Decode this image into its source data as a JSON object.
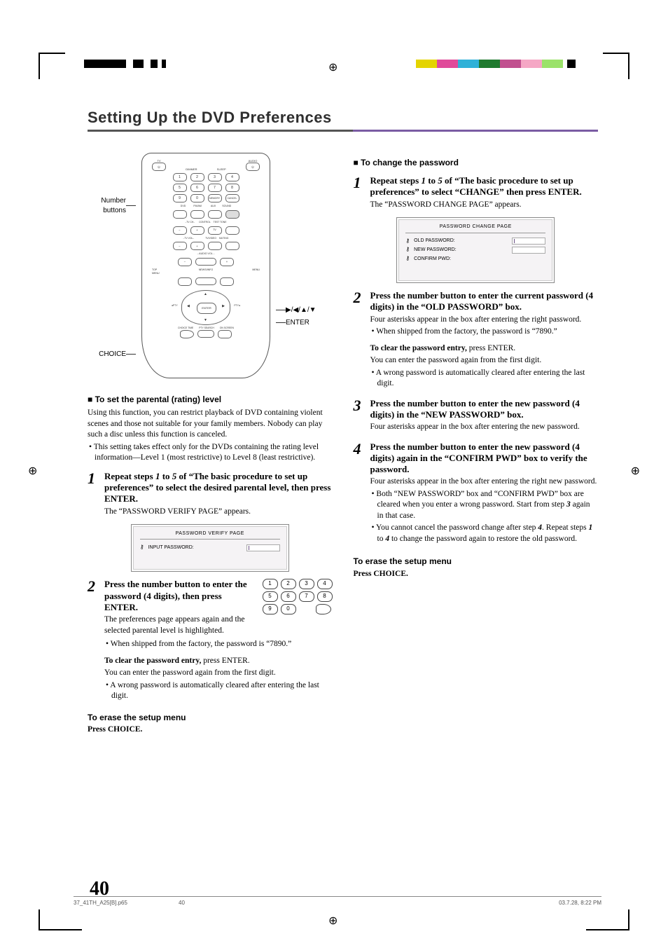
{
  "page_title": "Setting Up the DVD Preferences",
  "remote_callouts": {
    "number_buttons": "Number\nbuttons",
    "choice": "CHOICE",
    "navpad": "▶/◀/▲/▼",
    "enter": "ENTER"
  },
  "col_left": {
    "section_heading": "To set the parental (rating) level",
    "intro_p1": "Using this function, you can restrict playback of DVD containing violent scenes and those not suitable for your family members. Nobody can play such a disc unless this function is canceled.",
    "intro_bullet": "This setting takes effect only for the DVDs containing the rating level information—Level 1 (most restrictive) to Level 8 (least restrictive).",
    "step1_lead_a": "Repeat steps ",
    "step1_lead_b": " to ",
    "step1_lead_c": " of “The basic procedure to set up preferences” to select the desired parental level, then press ENTER.",
    "step1_ref_a": "1",
    "step1_ref_b": "5",
    "step1_note": "The “PASSWORD VERIFY PAGE” appears.",
    "osd1": {
      "title": "PASSWORD VERIFY PAGE",
      "field1": "INPUT PASSWORD:"
    },
    "step2_lead": "Press the number button to enter the password (4 digits), then press ENTER.",
    "step2_note": "The preferences page appears again and the selected parental level is highlighted.",
    "step2_bullet": "When shipped from the factory, the password is “7890.”",
    "step2_clear_label": "To clear the password entry,",
    "step2_clear_rest": " press ENTER.",
    "step2_clear_sub": "You can enter the password again from the first digit.",
    "step2_clear_bullet": "A wrong password is automatically cleared after entering the last digit.",
    "erase_heading": "To erase the setup menu",
    "erase_body": "Press CHOICE."
  },
  "col_right": {
    "section_heading": "To change the password",
    "step1_lead_a": "Repeat steps ",
    "step1_lead_b": " to ",
    "step1_lead_c": " of “The basic procedure to set up preferences” to select  “CHANGE” then press ENTER.",
    "step1_ref_a": "1",
    "step1_ref_b": "5",
    "step1_note": "The “PASSWORD CHANGE PAGE” appears.",
    "osd2": {
      "title": "PASSWORD CHANGE PAGE",
      "old": "OLD PASSWORD:",
      "new": "NEW PASSWORD:",
      "confirm": "CONFIRM PWD:"
    },
    "step2_lead": "Press the number button to enter the current password (4 digits) in the “OLD PASSWORD” box.",
    "step2_note": "Four asterisks appear in the box after entering the right password.",
    "step2_bullet": "When shipped from the factory, the password is “7890.”",
    "step2_clear_label": "To clear the password entry,",
    "step2_clear_rest": " press ENTER.",
    "step2_clear_sub": "You can enter the password again from the first digit.",
    "step2_clear_bullet": "A wrong password is automatically cleared after entering the last digit.",
    "step3_lead": "Press the number button to enter the new password (4 digits) in the “NEW PASSWORD” box.",
    "step3_note": "Four asterisks appear in the box after entering the new password.",
    "step4_lead": "Press the number button to enter the new password (4 digits) again in the “CONFIRM PWD” box to verify the password.",
    "step4_note": "Four asterisks appear in the box after entering the right new password.",
    "step4_bullet1_a": "Both “NEW PASSWORD” box and “CONFIRM PWD” box are cleared when you enter a wrong password. Start from step ",
    "step4_bullet1_ref": "3",
    "step4_bullet1_b": " again in that case.",
    "step4_bullet2_a": "You cannot cancel the password change after step ",
    "step4_bullet2_ref1": "4",
    "step4_bullet2_b": ". Repeat steps ",
    "step4_bullet2_ref2": "1",
    "step4_bullet2_c": " to ",
    "step4_bullet2_ref3": "4",
    "step4_bullet2_d": " to change the password again to restore the old password.",
    "erase_heading": "To erase the setup menu",
    "erase_body": "Press CHOICE."
  },
  "keypad": [
    "1",
    "2",
    "3",
    "4",
    "5",
    "6",
    "7",
    "8",
    "9",
    "0"
  ],
  "page_number": "40",
  "footer": {
    "file": "37_41TH_A25[B].p65",
    "page": "40",
    "datetime": "03.7.28, 8:22 PM"
  }
}
